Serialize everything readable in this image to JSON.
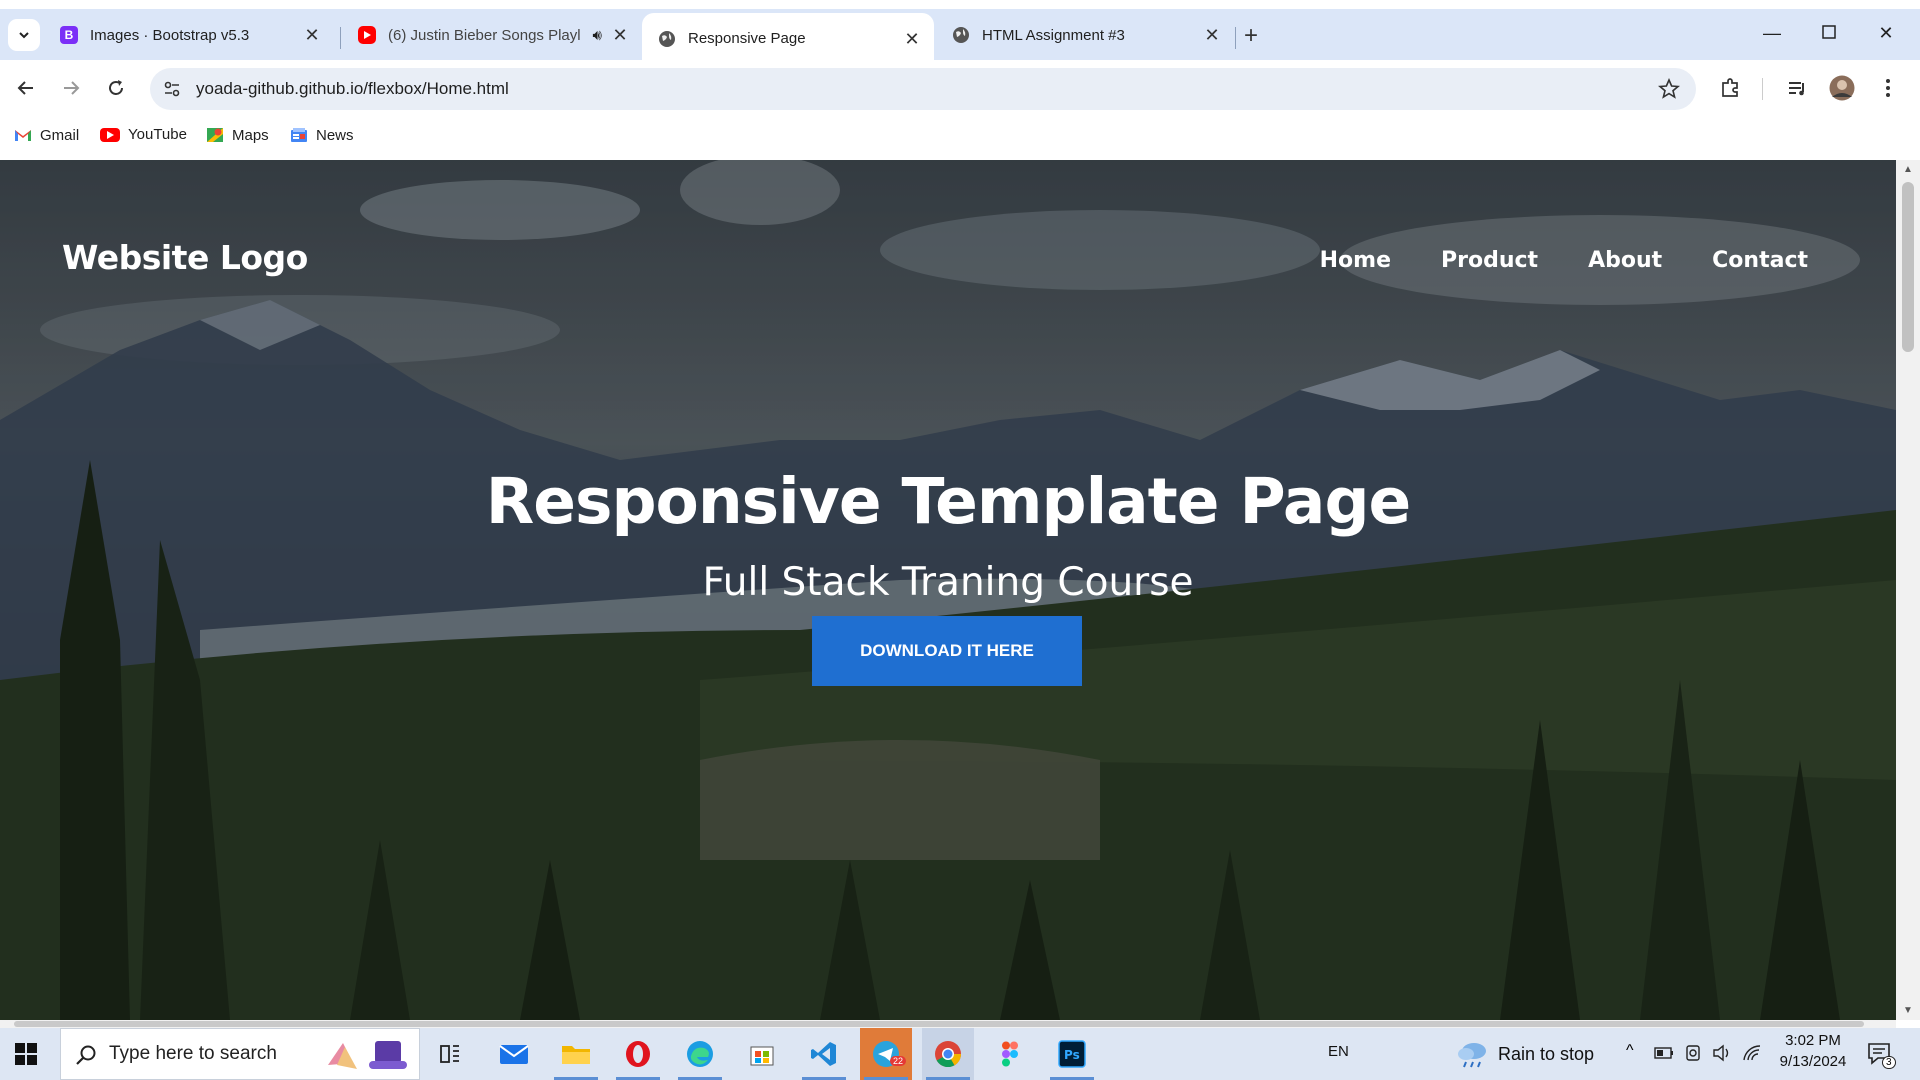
{
  "browser": {
    "tabs": [
      {
        "title": "Images · Bootstrap v5.3",
        "favicon": "bootstrap-icon"
      },
      {
        "title": "(6) Justin Bieber Songs Playl",
        "favicon": "youtube-icon",
        "audio": true
      },
      {
        "title": "Responsive Page",
        "favicon": "globe-icon",
        "active": true
      },
      {
        "title": "HTML Assignment #3",
        "favicon": "globe-icon"
      }
    ],
    "url": "yoada-github.github.io/flexbox/Home.html",
    "bookmarks": [
      {
        "label": "Gmail",
        "icon": "gmail-icon"
      },
      {
        "label": "YouTube",
        "icon": "youtube-icon"
      },
      {
        "label": "Maps",
        "icon": "maps-icon"
      },
      {
        "label": "News",
        "icon": "news-icon"
      }
    ]
  },
  "page": {
    "logo": "Website Logo",
    "nav": [
      "Home",
      "Product",
      "About",
      "Contact"
    ],
    "hero_title": "Responsive Template Page",
    "hero_subtitle": "Full Stack Traning Course",
    "cta": "DOWNLOAD IT HERE",
    "accent_color": "#1f6fd1"
  },
  "taskbar": {
    "search_placeholder": "Type here to search",
    "language": "EN",
    "weather": "Rain to stop",
    "time": "3:02 PM",
    "date": "9/13/2024",
    "telegram_badge": "22",
    "notifications": "3"
  }
}
